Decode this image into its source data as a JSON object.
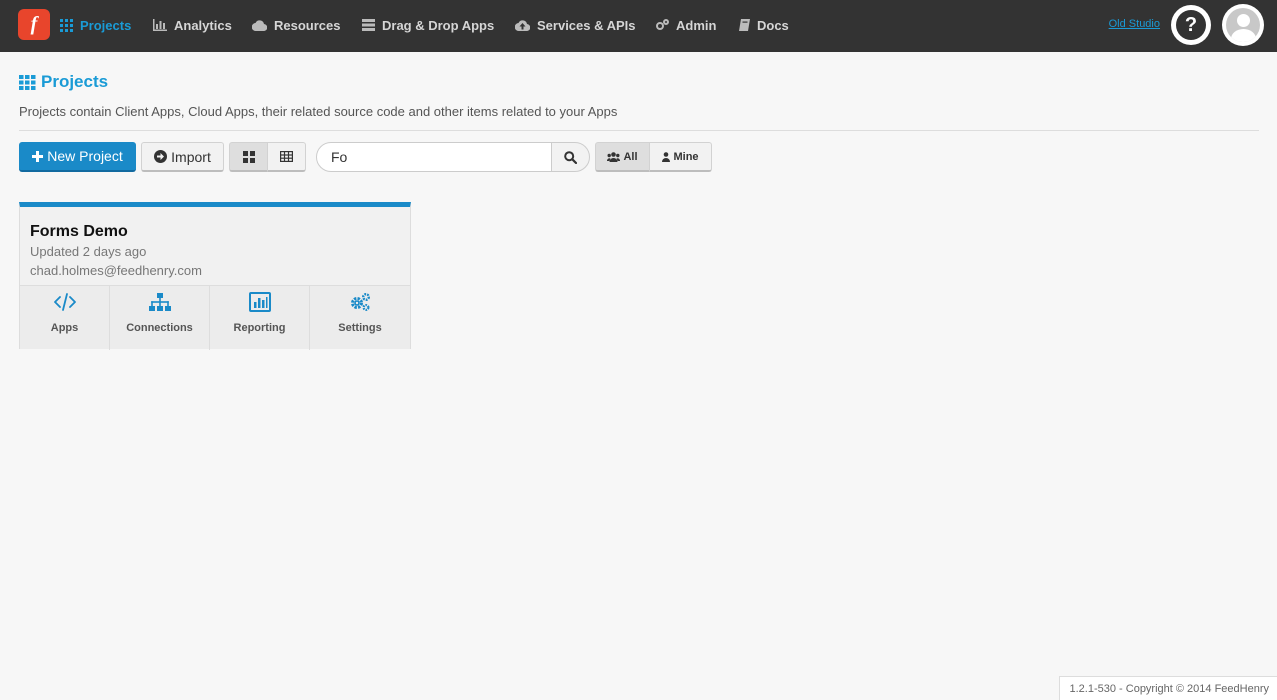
{
  "nav": {
    "logo_text": "f",
    "items": [
      {
        "label": "Projects",
        "icon": "grid-icon",
        "active": true
      },
      {
        "label": "Analytics",
        "icon": "bar-chart-icon"
      },
      {
        "label": "Resources",
        "icon": "cloud-icon"
      },
      {
        "label": "Drag & Drop Apps",
        "icon": "server-icon"
      },
      {
        "label": "Services & APIs",
        "icon": "cloud-upload-icon"
      },
      {
        "label": "Admin",
        "icon": "gears-icon"
      },
      {
        "label": "Docs",
        "icon": "book-icon"
      }
    ],
    "old_studio": "Old Studio",
    "help": "?"
  },
  "page": {
    "title": "Projects",
    "subtitle": "Projects contain Client Apps, Cloud Apps, their related source code and other items related to your Apps"
  },
  "toolbar": {
    "new_project": "New Project",
    "import": "Import",
    "search_value": "Fo",
    "filter_all": "All",
    "filter_mine": "Mine"
  },
  "projects": [
    {
      "title": "Forms Demo",
      "updated": "Updated 2 days ago",
      "owner": "chad.holmes@feedhenry.com",
      "actions": [
        {
          "label": "Apps",
          "icon": "code-icon"
        },
        {
          "label": "Connections",
          "icon": "sitemap-icon"
        },
        {
          "label": "Reporting",
          "icon": "reporting-chart-icon"
        },
        {
          "label": "Settings",
          "icon": "gears-icon"
        }
      ]
    }
  ],
  "footer": "1.2.1-530 - Copyright © 2014 FeedHenry",
  "colors": {
    "accent": "#1a9bd6",
    "primary_button": "#1a8ac8",
    "topbar": "#333333",
    "logo": "#e8452c"
  }
}
